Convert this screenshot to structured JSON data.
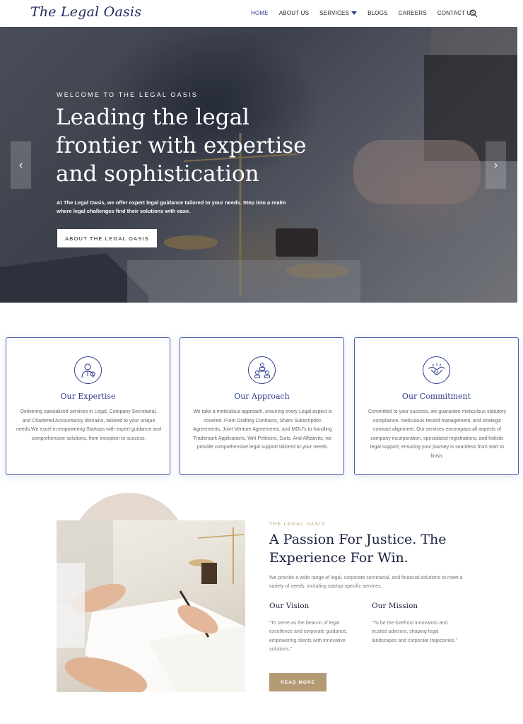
{
  "brand": {
    "logo": "The Legal Oasis"
  },
  "nav": {
    "items": [
      {
        "label": "HOME",
        "active": true
      },
      {
        "label": "ABOUT US"
      },
      {
        "label": "SERVICES",
        "dropdown": true
      },
      {
        "label": "BLOGS"
      },
      {
        "label": "CAREERS"
      },
      {
        "label": "CONTACT US"
      }
    ],
    "search_icon": "search-icon"
  },
  "hero": {
    "eyebrow": "WELCOME TO THE LEGAL OASIS",
    "title": "Leading the legal frontier with expertise and sophistication",
    "text": "At The Legal Oasis, we offer expert legal guidance tailored to your needs. Step into a realm where legal challenges find their solutions with ease.",
    "button": "ABOUT THE LEGAL OASIS",
    "prev_arrow": "‹",
    "next_arrow": "›"
  },
  "cards": [
    {
      "icon": "lawyer-icon",
      "title": "Our Expertise",
      "text": "Delivering specialized services in Legal, Company Secretarial, and Chartered Accountancy domains, tailored to your unique needs.We excel in empowering Startups with expert guidance and comprehensive solutions, from inception to success."
    },
    {
      "icon": "team-structure-icon",
      "title": "Our Approach",
      "text": "We take a meticulous approach, ensuring every Legal aspect is covered. From Drafting Contracts, Share Subscription Agreements, Joint Venture Agreements, and MOU's to handling Trademark Applications, Writ Petitions, Suits, And Affidavits, we provide comprehensive legal support tailored to your needs."
    },
    {
      "icon": "handshake-icon",
      "title": "Our Commitment",
      "text": "Committed to your success, we guarantee meticulous statutory compliance, meticulous record management, and strategic contract alignment. Our services encompass all aspects of company incorporation, specialized registrations, and holistic legal support, ensuring your journey is seamless from start to finish."
    }
  ],
  "about": {
    "eyebrow": "THE LEGAL OASIS",
    "title": "A Passion For Justice. The Experience For Win.",
    "text": "We provide a wide range of legal, corporate secretarial, and financial solutions to meet a variety of needs, including startup-specific services.",
    "vision_title": "Our Vision",
    "vision_text": "\"To serve as the beacon of legal excellence and corporate guidance, empowering clients with innovative solutions.\"",
    "mission_title": "Our Mission",
    "mission_text": "\"To be the forefront innovators and trusted advisors, shaping legal landscapes and corporate trajectories.\"",
    "button": "READ MORE"
  },
  "colors": {
    "primary": "#2d3e8f",
    "accent": "#b49a74",
    "heading": "#1b2040"
  }
}
